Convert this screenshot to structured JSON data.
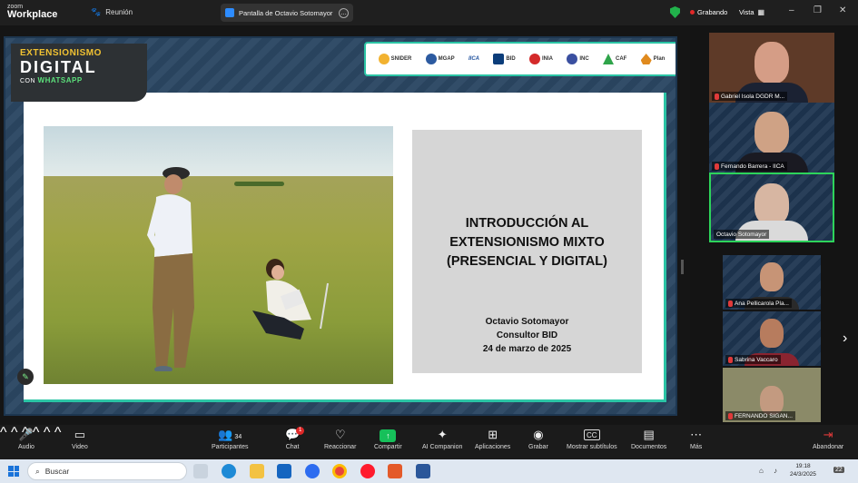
{
  "app": {
    "name_top": "zoom",
    "name_bottom": "Workplace"
  },
  "topbar": {
    "meeting_label": "Reunión",
    "share_label": "Pantalla de Octavio Sotomayor",
    "recording_label": "Grabando",
    "view_label": "Vista"
  },
  "slide": {
    "logo": {
      "line1": "EXTENSIONISMO",
      "line2": "DIGITAL",
      "line3_prefix": "CON",
      "line3_brand": "WHATSAPP"
    },
    "partners": [
      "SNIDER",
      "MGAP",
      "IICA",
      "BID",
      "INIA",
      "INC",
      "CAF",
      "Plan"
    ],
    "title_lines": [
      "INTRODUCCIÓN AL",
      "EXTENSIONISMO MIXTO",
      "(PRESENCIAL Y DIGITAL)"
    ],
    "author": "Octavio Sotomayor",
    "role": "Consultor BID",
    "date": "24 de marzo de 2025"
  },
  "participants": [
    {
      "name": "Gabriel Isola DGDR M..."
    },
    {
      "name": "Fernando Barrera - IICA"
    },
    {
      "name": "Octavio Sotomayor"
    },
    {
      "name": "Ana Pellicarola Pla..."
    },
    {
      "name": "Sabrina Vaccaro"
    },
    {
      "name": "FERNANDO SIGAN..."
    }
  ],
  "toolbar": {
    "audio": "Audio",
    "video": "Video",
    "participants": "Participantes",
    "participants_count": "34",
    "chat": "Chat",
    "chat_badge": "1",
    "react": "Reaccionar",
    "share": "Compartir",
    "companion": "AI Companion",
    "apps": "Aplicaciones",
    "record": "Grabar",
    "captions": "Mostrar subtítulos",
    "docs": "Documentos",
    "more": "Más",
    "leave": "Abandonar"
  },
  "taskbar": {
    "search_placeholder": "Buscar",
    "time": "19:18",
    "date": "24/3/2025",
    "notification_count": "22"
  },
  "colors": {
    "accent_green": "#2dd45b",
    "slide_teal": "#2bc4a5",
    "record_red": "#e02828"
  }
}
